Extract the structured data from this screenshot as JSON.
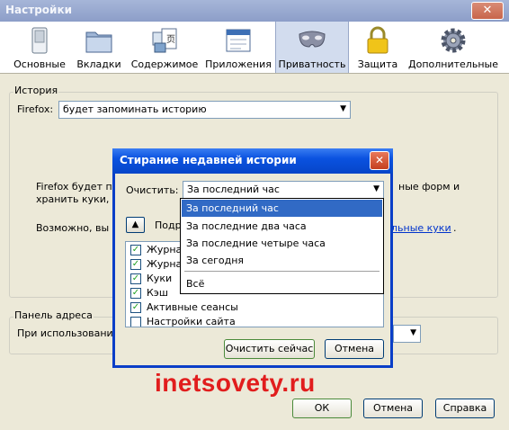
{
  "window": {
    "title": "Настройки",
    "close_glyph": "✕"
  },
  "toolbar": {
    "tabs": [
      {
        "label": "Основные",
        "icon": "switch-icon"
      },
      {
        "label": "Вкладки",
        "icon": "folder-tabs-icon"
      },
      {
        "label": "Содержимое",
        "icon": "content-icon"
      },
      {
        "label": "Приложения",
        "icon": "applications-icon"
      },
      {
        "label": "Приватность",
        "icon": "mask-icon",
        "selected": true
      },
      {
        "label": "Защита",
        "icon": "lock-icon"
      },
      {
        "label": "Дополнительные",
        "icon": "gear-icon"
      }
    ]
  },
  "history": {
    "legend": "История",
    "firefox_label": "Firefox:",
    "mode_value": "будет запоминать историю",
    "para1_a": "Firefox будет по",
    "para1_b": "ные форм и",
    "para1_c": "хранить куки, о",
    "para2_a": "Возможно, вы за",
    "para2_link": "льные куки",
    "para2_end": "."
  },
  "address_bar": {
    "legend": "Панель адреса",
    "text": "При использовании п"
  },
  "buttons": {
    "ok": "ОК",
    "cancel": "Отмена",
    "help": "Справка"
  },
  "dialog": {
    "title": "Стирание недавней истории",
    "clear_label": "Очистить:",
    "clear_value": "За последний час",
    "details_label": "Подро",
    "expander_glyph": "▲",
    "items": [
      {
        "label": "Журнал",
        "checked": true
      },
      {
        "label": "Журнал",
        "checked": true
      },
      {
        "label": "Куки",
        "checked": true
      },
      {
        "label": "Кэш",
        "checked": true
      },
      {
        "label": "Активные сеансы",
        "checked": true
      },
      {
        "label": "Настройки сайта",
        "checked": false
      }
    ],
    "clear_now": "Очистить сейчас",
    "cancel": "Отмена"
  },
  "dropdown": {
    "options": [
      "За последний час",
      "За последние два часа",
      "За последние четыре часа",
      "За сегодня",
      "Всё"
    ],
    "selected_index": 0
  },
  "watermark": "inetsovety.ru",
  "colors": {
    "selection": "#316ac5",
    "link": "#0033cc",
    "watermark": "#e11d1d",
    "dialog_title": "#0a52e0"
  }
}
